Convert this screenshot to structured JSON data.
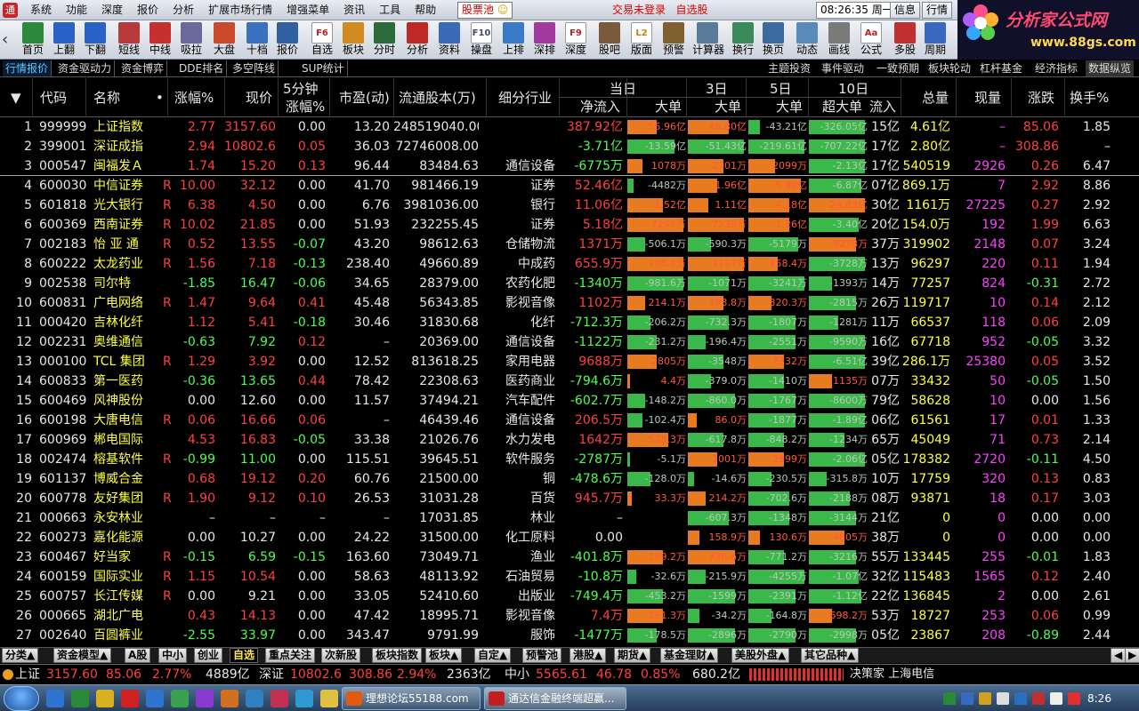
{
  "menubar": {
    "items": [
      "系统",
      "功能",
      "深度",
      "报价",
      "分析",
      "扩展市场行情",
      "增强菜单",
      "资讯",
      "工具",
      "帮助"
    ],
    "pool": "股票池",
    "trade_status": "交易未登录",
    "watchlist": "自选股",
    "clock": "08:26:35 周一",
    "info": "信息",
    "quote": "行情"
  },
  "logo": {
    "line1": "分析家公式网",
    "line2": "www.88gs.com"
  },
  "toolbar": [
    {
      "label": "首页",
      "color": "#2c8a3c"
    },
    {
      "label": "上翻",
      "color": "#2a62c8"
    },
    {
      "label": "下翻",
      "color": "#2a62c8"
    },
    {
      "label": "短线",
      "color": "#b83a3a"
    },
    {
      "label": "中线",
      "color": "#c83030"
    },
    {
      "label": "吸拉",
      "color": "#6a6a9a"
    },
    {
      "label": "大盘",
      "color": "#c84a2a"
    },
    {
      "label": "十档",
      "color": "#3a72c0"
    },
    {
      "label": "报价",
      "color": "#3060a0"
    },
    {
      "label": "自选",
      "color": "#c02020",
      "icon": "F6"
    },
    {
      "label": "板块",
      "color": "#d08a20"
    },
    {
      "label": "分时",
      "color": "#2d6a3a"
    },
    {
      "label": "分析",
      "color": "#c02828"
    },
    {
      "label": "资料",
      "color": "#3a6ab8"
    },
    {
      "label": "操盘",
      "color": "#4a4a6a",
      "icon": "F10"
    },
    {
      "label": "上排",
      "color": "#3a7ac8"
    },
    {
      "label": "深排",
      "color": "#a03aa0"
    },
    {
      "label": "深度",
      "color": "#c02020",
      "icon": "F9"
    },
    {
      "label": "股吧",
      "color": "#7a5a3a"
    },
    {
      "label": "版面",
      "color": "#d07a10",
      "icon": "L2"
    },
    {
      "label": "预警",
      "color": "#806030"
    },
    {
      "label": "计算器",
      "color": "#5a7a9a"
    },
    {
      "label": "换行",
      "color": "#3a8a5a"
    },
    {
      "label": "换页",
      "color": "#3a6aa0"
    },
    {
      "label": "动态",
      "color": "#5a8ab8"
    },
    {
      "label": "画线",
      "color": "#7a7a7a"
    },
    {
      "label": "公式",
      "color": "#c02020",
      "icon": "Aa"
    },
    {
      "label": "多股",
      "color": "#c03030"
    },
    {
      "label": "周期",
      "color": "#3a6ac0"
    }
  ],
  "tabs_left": [
    "行情报价",
    "资金驱动力",
    "资金博弈",
    "DDE排名",
    "多空阵线",
    "SUP统计"
  ],
  "tabs_right": [
    "主题投资",
    "事件驱动",
    "一致预期",
    "板块轮动",
    "杠杆基金",
    "经济指标",
    "数据纵览"
  ],
  "columns": {
    "code": "代码",
    "name": "名称",
    "change": "涨幅%",
    "price": "现价",
    "min5_top": "5分钟",
    "min5_bot": "涨幅%",
    "pe": "市盈(动)",
    "float": "流通股本(万)",
    "industry": "细分行业",
    "today": "当日",
    "netin": "净流入",
    "big": "大单",
    "d3": "3日",
    "d3big": "大单",
    "d5": "5日",
    "d5big": "大单",
    "d10": "10日",
    "d10sup": "超大单",
    "d10net": "流入",
    "vol": "总量",
    "cur": "现量",
    "updown": "涨跌",
    "turnover": "换手%"
  },
  "rows": [
    {
      "no": "1",
      "code": "999999",
      "name": "上证指数",
      "r": "",
      "chg": "2.77",
      "price": "3157.60",
      "m5": "0.00",
      "pe": "13.20",
      "flt": "248519040.00",
      "ind": "",
      "net": "387.92亿",
      "b1": "55.96亿",
      "b1f": 0.5,
      "b1c": "o",
      "b3": "46.80亿",
      "b3f": 0.7,
      "b3c": "o",
      "b5": "-43.21亿",
      "b5f": 0.2,
      "b5c": "g",
      "b10": "-326.05亿",
      "b10f": 0.95,
      "b10c": "g",
      "d10n": "15亿",
      "vol": "4.61亿",
      "cur": "–",
      "ud": "85.06",
      "to": "1.85"
    },
    {
      "no": "2",
      "code": "399001",
      "name": "深证成指",
      "r": "",
      "chg": "2.94",
      "price": "10802.64",
      "m5": "0.05",
      "pe": "36.03",
      "flt": "72746008.00",
      "ind": "",
      "net": "-3.71亿",
      "b1": "-13.59亿",
      "b1f": 0.8,
      "b1c": "g",
      "b3": "-51.43亿",
      "b3f": 0.95,
      "b3c": "g",
      "b5": "-219.61亿",
      "b5f": 0.95,
      "b5c": "g",
      "b10": "-707.22亿",
      "b10f": 0.95,
      "b10c": "g",
      "d10n": "17亿",
      "vol": "2.80亿",
      "cur": "–",
      "ud": "308.86",
      "to": "–"
    },
    {
      "no": "3",
      "code": "000547",
      "name": "闽福发Ａ",
      "r": "",
      "chg": "1.74",
      "price": "15.20",
      "m5": "0.13",
      "pe": "96.44",
      "flt": "83484.63",
      "ind": "通信设备",
      "net": "-6775万",
      "b1": "1078万",
      "b1f": 0.25,
      "b1c": "o",
      "b3": "2701万",
      "b3f": 0.6,
      "b3c": "o",
      "b5": "2099万",
      "b5f": 0.45,
      "b5c": "o",
      "b10": "-2.13亿",
      "b10f": 0.95,
      "b10c": "g",
      "d10n": "17亿",
      "vol": "540519",
      "cur": "2926",
      "ud": "0.26",
      "to": "6.47"
    },
    {
      "no": "4",
      "code": "600030",
      "name": "中信证券",
      "r": "R",
      "chg": "10.00",
      "price": "32.12",
      "m5": "0.00",
      "pe": "41.70",
      "flt": "981466.19",
      "ind": "证券",
      "net": "52.46亿",
      "b1": "-4482万",
      "b1f": 0.1,
      "b1c": "g",
      "b3": "1.96亿",
      "b3f": 0.5,
      "b3c": "o",
      "b5": "5.89亿",
      "b5f": 0.9,
      "b5c": "o",
      "b10": "-6.87亿",
      "b10f": 0.9,
      "b10c": "g",
      "d10n": "07亿",
      "vol": "869.1万",
      "cur": "7",
      "ud": "2.92",
      "to": "8.86"
    },
    {
      "no": "5",
      "code": "601818",
      "name": "光大银行",
      "r": "R",
      "chg": "6.38",
      "price": "4.50",
      "m5": "0.00",
      "pe": "6.76",
      "flt": "3981036.00",
      "ind": "银行",
      "net": "11.06亿",
      "b1": "1.52亿",
      "b1f": 0.6,
      "b1c": "o",
      "b3": "1.11亿",
      "b3f": 0.35,
      "b3c": "o",
      "b5": "4.18亿",
      "b5f": 0.7,
      "b5c": "o",
      "b10": "24.83亿",
      "b10f": 0.95,
      "b10c": "o",
      "d10n": "30亿",
      "vol": "1161万",
      "cur": "27225",
      "ud": "0.27",
      "to": "2.92"
    },
    {
      "no": "6",
      "code": "600369",
      "name": "西南证券",
      "r": "R",
      "chg": "10.02",
      "price": "21.85",
      "m5": "0.00",
      "pe": "51.93",
      "flt": "232255.45",
      "ind": "证券",
      "net": "5.18亿",
      "b1": "7255万",
      "b1f": 0.95,
      "b1c": "o",
      "b3": "7235万",
      "b3f": 0.95,
      "b3c": "o",
      "b5": "1.26亿",
      "b5f": 0.7,
      "b5c": "o",
      "b10": "-3.40亿",
      "b10f": 0.85,
      "b10c": "g",
      "d10n": "20亿",
      "vol": "154.0万",
      "cur": "192",
      "ud": "1.99",
      "to": "6.63"
    },
    {
      "no": "7",
      "code": "002183",
      "name": "怡 亚 通",
      "r": "R",
      "chg": "0.52",
      "price": "13.55",
      "m5": "-0.07",
      "pe": "43.20",
      "flt": "98612.63",
      "ind": "仓储物流",
      "net": "1371万",
      "b1": "-506.1万",
      "b1f": 0.3,
      "b1c": "g",
      "b3": "-590.3万",
      "b3f": 0.4,
      "b3c": "g",
      "b5": "-5179万",
      "b5f": 0.85,
      "b5c": "g",
      "b10": "8278万",
      "b10f": 0.8,
      "b10c": "o",
      "d10n": "37万",
      "vol": "319902",
      "cur": "2148",
      "ud": "0.07",
      "to": "3.24"
    },
    {
      "no": "8",
      "code": "600222",
      "name": "太龙药业",
      "r": "R",
      "chg": "1.56",
      "price": "7.18",
      "m5": "-0.13",
      "pe": "238.40",
      "flt": "49660.89",
      "ind": "中成药",
      "net": "655.9万",
      "b1": "706.4万",
      "b1f": 0.95,
      "b1c": "o",
      "b3": "1117万",
      "b3f": 0.95,
      "b3c": "o",
      "b5": "458.4万",
      "b5f": 0.5,
      "b5c": "o",
      "b10": "-3728万",
      "b10f": 0.95,
      "b10c": "g",
      "d10n": "13万",
      "vol": "96297",
      "cur": "220",
      "ud": "0.11",
      "to": "1.94"
    },
    {
      "no": "9",
      "code": "002538",
      "name": "司尔特",
      "r": "",
      "chg": "-1.85",
      "price": "16.47",
      "m5": "-0.06",
      "pe": "34.65",
      "flt": "28379.00",
      "ind": "农药化肥",
      "net": "-1340万",
      "b1": "-981.6万",
      "b1f": 0.95,
      "b1c": "g",
      "b3": "-1071万",
      "b3f": 0.7,
      "b3c": "g",
      "b5": "-3241万",
      "b5f": 0.95,
      "b5c": "g",
      "b10": "-1393万",
      "b10f": 0.4,
      "b10c": "g",
      "d10n": "14万",
      "vol": "77257",
      "cur": "824",
      "ud": "-0.31",
      "to": "2.72"
    },
    {
      "no": "10",
      "code": "600831",
      "name": "广电网络",
      "r": "R",
      "chg": "1.47",
      "price": "9.64",
      "m5": "0.41",
      "pe": "45.48",
      "flt": "56343.85",
      "ind": "影视音像",
      "net": "1102万",
      "b1": "214.1万",
      "b1f": 0.3,
      "b1c": "o",
      "b3": "493.8万",
      "b3f": 0.6,
      "b3c": "o",
      "b5": "320.3万",
      "b5f": 0.4,
      "b5c": "o",
      "b10": "-2815万",
      "b10f": 0.8,
      "b10c": "g",
      "d10n": "26万",
      "vol": "119717",
      "cur": "10",
      "ud": "0.14",
      "to": "2.12"
    },
    {
      "no": "11",
      "code": "000420",
      "name": "吉林化纤",
      "r": "",
      "chg": "1.12",
      "price": "5.41",
      "m5": "-0.18",
      "pe": "30.46",
      "flt": "31830.68",
      "ind": "化纤",
      "net": "-712.3万",
      "b1": "-206.2万",
      "b1f": 0.4,
      "b1c": "g",
      "b3": "-732.3万",
      "b3f": 0.7,
      "b3c": "g",
      "b5": "-1807万",
      "b5f": 0.8,
      "b5c": "g",
      "b10": "-1281万",
      "b10f": 0.5,
      "b10c": "g",
      "d10n": "11万",
      "vol": "66537",
      "cur": "118",
      "ud": "0.06",
      "to": "2.09"
    },
    {
      "no": "12",
      "code": "002231",
      "name": "奥维通信",
      "r": "",
      "chg": "-0.63",
      "price": "7.92",
      "m5": "0.12",
      "pe": "–",
      "flt": "20369.00",
      "ind": "通信设备",
      "net": "-1122万",
      "b1": "-231.2万",
      "b1f": 0.5,
      "b1c": "g",
      "b3": "-196.4万",
      "b3f": 0.3,
      "b3c": "g",
      "b5": "-2551万",
      "b5f": 0.8,
      "b5c": "g",
      "b10": "-9590万",
      "b10f": 0.95,
      "b10c": "g",
      "d10n": "16亿",
      "vol": "67718",
      "cur": "952",
      "ud": "-0.05",
      "to": "3.32"
    },
    {
      "no": "13",
      "code": "000100",
      "name": "TCL 集团",
      "r": "R",
      "chg": "1.29",
      "price": "3.92",
      "m5": "0.00",
      "pe": "12.52",
      "flt": "813618.25",
      "ind": "家用电器",
      "net": "9688万",
      "b1": "2805万",
      "b1f": 0.5,
      "b1c": "o",
      "b3": "-3548万",
      "b3f": 0.6,
      "b3c": "g",
      "b5": "7332万",
      "b5f": 0.6,
      "b5c": "o",
      "b10": "-6.51亿",
      "b10f": 0.95,
      "b10c": "g",
      "d10n": "39亿",
      "vol": "286.1万",
      "cur": "25380",
      "ud": "0.05",
      "to": "3.52"
    },
    {
      "no": "14",
      "code": "600833",
      "name": "第一医药",
      "r": "",
      "chg": "-0.36",
      "price": "13.65",
      "m5": "0.44",
      "pe": "78.42",
      "flt": "22308.63",
      "ind": "医药商业",
      "net": "-794.6万",
      "b1": "4.4万",
      "b1f": 0.05,
      "b1c": "o",
      "b3": "-379.0万",
      "b3f": 0.4,
      "b3c": "g",
      "b5": "-1410万",
      "b5f": 0.6,
      "b5c": "g",
      "b10": "1135万",
      "b10f": 0.4,
      "b10c": "o",
      "d10n": "07万",
      "vol": "33432",
      "cur": "50",
      "ud": "-0.05",
      "to": "1.50"
    },
    {
      "no": "15",
      "code": "600469",
      "name": "风神股份",
      "r": "",
      "chg": "0.00",
      "price": "12.60",
      "m5": "0.00",
      "pe": "11.57",
      "flt": "37494.21",
      "ind": "汽车配件",
      "net": "-602.7万",
      "b1": "-148.2万",
      "b1f": 0.3,
      "b1c": "g",
      "b3": "-860.0万",
      "b3f": 0.8,
      "b3c": "g",
      "b5": "-1767万",
      "b5f": 0.8,
      "b5c": "g",
      "b10": "-8600万",
      "b10f": 0.95,
      "b10c": "g",
      "d10n": "79亿",
      "vol": "58628",
      "cur": "10",
      "ud": "0.00",
      "to": "1.56"
    },
    {
      "no": "16",
      "code": "600198",
      "name": "大唐电信",
      "r": "R",
      "chg": "0.06",
      "price": "16.66",
      "m5": "0.06",
      "pe": "–",
      "flt": "46439.46",
      "ind": "通信设备",
      "net": "206.5万",
      "b1": "-102.4万",
      "b1f": 0.25,
      "b1c": "g",
      "b3": "86.0万",
      "b3f": 0.15,
      "b3c": "o",
      "b5": "-1877万",
      "b5f": 0.8,
      "b5c": "g",
      "b10": "-1.89亿",
      "b10f": 0.95,
      "b10c": "g",
      "d10n": "06亿",
      "vol": "61561",
      "cur": "17",
      "ud": "0.01",
      "to": "1.33"
    },
    {
      "no": "17",
      "code": "600969",
      "name": "郴电国际",
      "r": "",
      "chg": "4.53",
      "price": "16.83",
      "m5": "-0.05",
      "pe": "33.38",
      "flt": "21026.76",
      "ind": "水力发电",
      "net": "1642万",
      "b1": "528.3万",
      "b1f": 0.7,
      "b1c": "o",
      "b3": "-617.8万",
      "b3f": 0.6,
      "b3c": "g",
      "b5": "-848.2万",
      "b5f": 0.6,
      "b5c": "g",
      "b10": "-1234万",
      "b10f": 0.6,
      "b10c": "g",
      "d10n": "65万",
      "vol": "45049",
      "cur": "71",
      "ud": "0.73",
      "to": "2.14"
    },
    {
      "no": "18",
      "code": "002474",
      "name": "榕基软件",
      "r": "R",
      "chg": "-0.99",
      "price": "11.00",
      "m5": "0.00",
      "pe": "115.51",
      "flt": "39645.51",
      "ind": "软件服务",
      "net": "-2787万",
      "b1": "-5.1万",
      "b1f": 0.05,
      "b1c": "g",
      "b3": "1001万",
      "b3f": 0.5,
      "b3c": "o",
      "b5": "2899万",
      "b5f": 0.6,
      "b5c": "o",
      "b10": "-2.06亿",
      "b10f": 0.95,
      "b10c": "g",
      "d10n": "05亿",
      "vol": "178382",
      "cur": "2720",
      "ud": "-0.11",
      "to": "4.50"
    },
    {
      "no": "19",
      "code": "601137",
      "name": "博威合金",
      "r": "",
      "chg": "0.68",
      "price": "19.12",
      "m5": "0.20",
      "pe": "60.76",
      "flt": "21500.00",
      "ind": "铜",
      "net": "-478.6万",
      "b1": "-128.0万",
      "b1f": 0.4,
      "b1c": "g",
      "b3": "-14.6万",
      "b3f": 0.1,
      "b3c": "g",
      "b5": "-230.5万",
      "b5f": 0.4,
      "b5c": "g",
      "b10": "-315.8万",
      "b10f": 0.3,
      "b10c": "g",
      "d10n": "10万",
      "vol": "17759",
      "cur": "320",
      "ud": "0.13",
      "to": "0.83"
    },
    {
      "no": "20",
      "code": "600778",
      "name": "友好集团",
      "r": "R",
      "chg": "1.90",
      "price": "9.12",
      "m5": "0.10",
      "pe": "26.53",
      "flt": "31031.28",
      "ind": "百货",
      "net": "945.7万",
      "b1": "33.3万",
      "b1f": 0.08,
      "b1c": "o",
      "b3": "214.2万",
      "b3f": 0.3,
      "b3c": "o",
      "b5": "-702.6万",
      "b5f": 0.7,
      "b5c": "g",
      "b10": "-2188万",
      "b10f": 0.7,
      "b10c": "g",
      "d10n": "08万",
      "vol": "93871",
      "cur": "18",
      "ud": "0.17",
      "to": "3.03"
    },
    {
      "no": "21",
      "code": "000663",
      "name": "永安林业",
      "r": "",
      "chg": "–",
      "price": "–",
      "m5": "–",
      "pe": "–",
      "flt": "17031.85",
      "ind": "林业",
      "net": "–",
      "b1": "",
      "b1f": 0,
      "b1c": "g",
      "b3": "-607.3万",
      "b3f": 0.7,
      "b3c": "g",
      "b5": "-1348万",
      "b5f": 0.7,
      "b5c": "g",
      "b10": "-3144万",
      "b10f": 0.8,
      "b10c": "g",
      "d10n": "21亿",
      "vol": "0",
      "cur": "0",
      "ud": "0.00",
      "to": "0.00"
    },
    {
      "no": "22",
      "code": "600273",
      "name": "嘉化能源",
      "r": "",
      "chg": "0.00",
      "price": "10.27",
      "m5": "0.00",
      "pe": "24.22",
      "flt": "31500.00",
      "ind": "化工原料",
      "net": "0.00",
      "b1": "",
      "b1f": 0,
      "b1c": "g",
      "b3": "158.9万",
      "b3f": 0.2,
      "b3c": "o",
      "b5": "130.6万",
      "b5f": 0.2,
      "b5c": "o",
      "b10": "4605万",
      "b10f": 0.6,
      "b10c": "o",
      "d10n": "38万",
      "vol": "0",
      "cur": "0",
      "ud": "0.00",
      "to": "0.00"
    },
    {
      "no": "23",
      "code": "600467",
      "name": "好当家",
      "r": "R",
      "chg": "-0.15",
      "price": "6.59",
      "m5": "-0.15",
      "pe": "163.60",
      "flt": "73049.71",
      "ind": "渔业",
      "net": "-401.8万",
      "b1": "169.2万",
      "b1f": 0.6,
      "b1c": "o",
      "b3": "736.6万",
      "b3f": 0.8,
      "b3c": "o",
      "b5": "-771.2万",
      "b5f": 0.6,
      "b5c": "g",
      "b10": "-3216万",
      "b10f": 0.8,
      "b10c": "g",
      "d10n": "55万",
      "vol": "133445",
      "cur": "255",
      "ud": "-0.01",
      "to": "1.83"
    },
    {
      "no": "24",
      "code": "600159",
      "name": "国际实业",
      "r": "R",
      "chg": "1.15",
      "price": "10.54",
      "m5": "0.00",
      "pe": "58.63",
      "flt": "48113.92",
      "ind": "石油贸易",
      "net": "-10.8万",
      "b1": "-32.6万",
      "b1f": 0.15,
      "b1c": "g",
      "b3": "-215.9万",
      "b3f": 0.3,
      "b3c": "g",
      "b5": "-4255万",
      "b5f": 0.95,
      "b5c": "g",
      "b10": "-1.07亿",
      "b10f": 0.85,
      "b10c": "g",
      "d10n": "32亿",
      "vol": "115483",
      "cur": "1565",
      "ud": "0.12",
      "to": "2.40"
    },
    {
      "no": "25",
      "code": "600757",
      "name": "长江传媒",
      "r": "R",
      "chg": "0.00",
      "price": "9.21",
      "m5": "0.00",
      "pe": "33.05",
      "flt": "52410.60",
      "ind": "出版业",
      "net": "-749.4万",
      "b1": "-453.2万",
      "b1f": 0.6,
      "b1c": "g",
      "b3": "-1599万",
      "b3f": 0.8,
      "b3c": "g",
      "b5": "-2391万",
      "b5f": 0.8,
      "b5c": "g",
      "b10": "-1.12亿",
      "b10f": 0.9,
      "b10c": "g",
      "d10n": "22亿",
      "vol": "136845",
      "cur": "2",
      "ud": "0.00",
      "to": "2.61"
    },
    {
      "no": "26",
      "code": "000665",
      "name": "湖北广电",
      "r": "",
      "chg": "0.43",
      "price": "14.13",
      "m5": "0.00",
      "pe": "47.42",
      "flt": "18995.71",
      "ind": "影视音像",
      "net": "7.4万",
      "b1": "151.3万",
      "b1f": 0.6,
      "b1c": "o",
      "b3": "-34.2万",
      "b3f": 0.2,
      "b3c": "g",
      "b5": "-164.8万",
      "b5f": 0.4,
      "b5c": "g",
      "b10": "698.2万",
      "b10f": 0.4,
      "b10c": "o",
      "d10n": "53万",
      "vol": "18727",
      "cur": "253",
      "ud": "0.06",
      "to": "0.99"
    },
    {
      "no": "27",
      "code": "002640",
      "name": "百圆裤业",
      "r": "",
      "chg": "-2.55",
      "price": "33.97",
      "m5": "0.00",
      "pe": "343.47",
      "flt": "9791.99",
      "ind": "服饰",
      "net": "-1477万",
      "b1": "-178.5万",
      "b1f": 0.5,
      "b1c": "g",
      "b3": "-2896万",
      "b3f": 0.8,
      "b3c": "g",
      "b5": "-2790万",
      "b5f": 0.8,
      "b5c": "g",
      "b10": "-2998万",
      "b10f": 0.8,
      "b10c": "g",
      "d10n": "05亿",
      "vol": "23867",
      "cur": "208",
      "ud": "-0.89",
      "to": "2.44"
    }
  ],
  "bottom_tabs": [
    {
      "label": "分类▲"
    },
    {
      "label": "资金模型▲"
    },
    {
      "label": "A股"
    },
    {
      "label": "中小"
    },
    {
      "label": "创业"
    },
    {
      "label": "自选",
      "active": true
    },
    {
      "label": "重点关注"
    },
    {
      "label": "次新股"
    },
    {
      "label": "板块指数"
    },
    {
      "label": "板块▲"
    },
    {
      "label": "自定▲"
    },
    {
      "label": "预警池"
    },
    {
      "label": "港股▲"
    },
    {
      "label": "期货▲"
    },
    {
      "label": "基金理财▲"
    },
    {
      "label": "美股外盘▲"
    },
    {
      "label": "其它品种▲"
    }
  ],
  "ticker": {
    "sh_label": "上证",
    "sh_price": "3157.60",
    "sh_chg": "85.06",
    "sh_pct": "2.77%",
    "sh_amt": "4889亿",
    "sz_label": "深证",
    "sz_price": "10802.6",
    "sz_chg": "308.86",
    "sz_pct": "2.94%",
    "sz_amt": "2363亿",
    "zx_label": "中小",
    "zx_price": "5565.61",
    "zx_chg": "46.78",
    "zx_pct": "0.85%",
    "zx_amt": "680.2亿",
    "news": "决策家 上海电信"
  },
  "taskbar": {
    "task1": "理想论坛55188.com",
    "task2": "通达信金融终端超赢...",
    "time": "8:26"
  },
  "colors": {
    "red": "#ff4040",
    "green": "#4cff4c",
    "white": "#e8e8e8",
    "yellow": "#ffff40",
    "cyan": "#5cf",
    "magenta": "#ff40ff",
    "orange_bar": "#e87a20",
    "green_bar": "#3bb84a"
  }
}
